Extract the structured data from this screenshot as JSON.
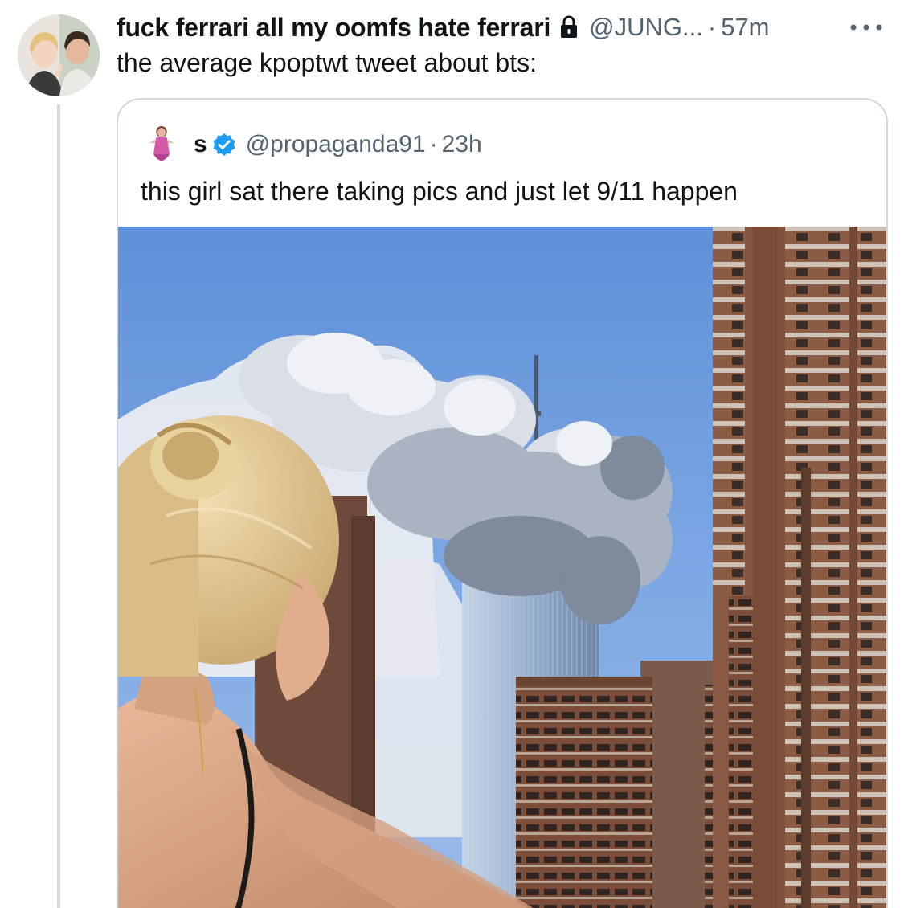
{
  "tweet": {
    "display_name": "fuck ferrari all my oomfs hate ferrari",
    "handle": "@JUNG...",
    "separator": "·",
    "time": "57m",
    "text": "the average kpoptwt tweet about bts:",
    "avatar_icon": "profile-photo",
    "protected_icon": "lock-icon",
    "more_icon": "more-dots-icon"
  },
  "quote": {
    "display_name": "s",
    "handle": "@propaganda91",
    "separator": "·",
    "time": "23h",
    "text": "this girl sat there taking pics and just let 9/11 happen",
    "verified_icon": "verified-badge-icon",
    "verified_color": "#1d9bf0",
    "media_icon": "photo"
  },
  "colors": {
    "text_primary": "#0f1419",
    "text_secondary": "#536471",
    "border": "#cfd9de"
  }
}
